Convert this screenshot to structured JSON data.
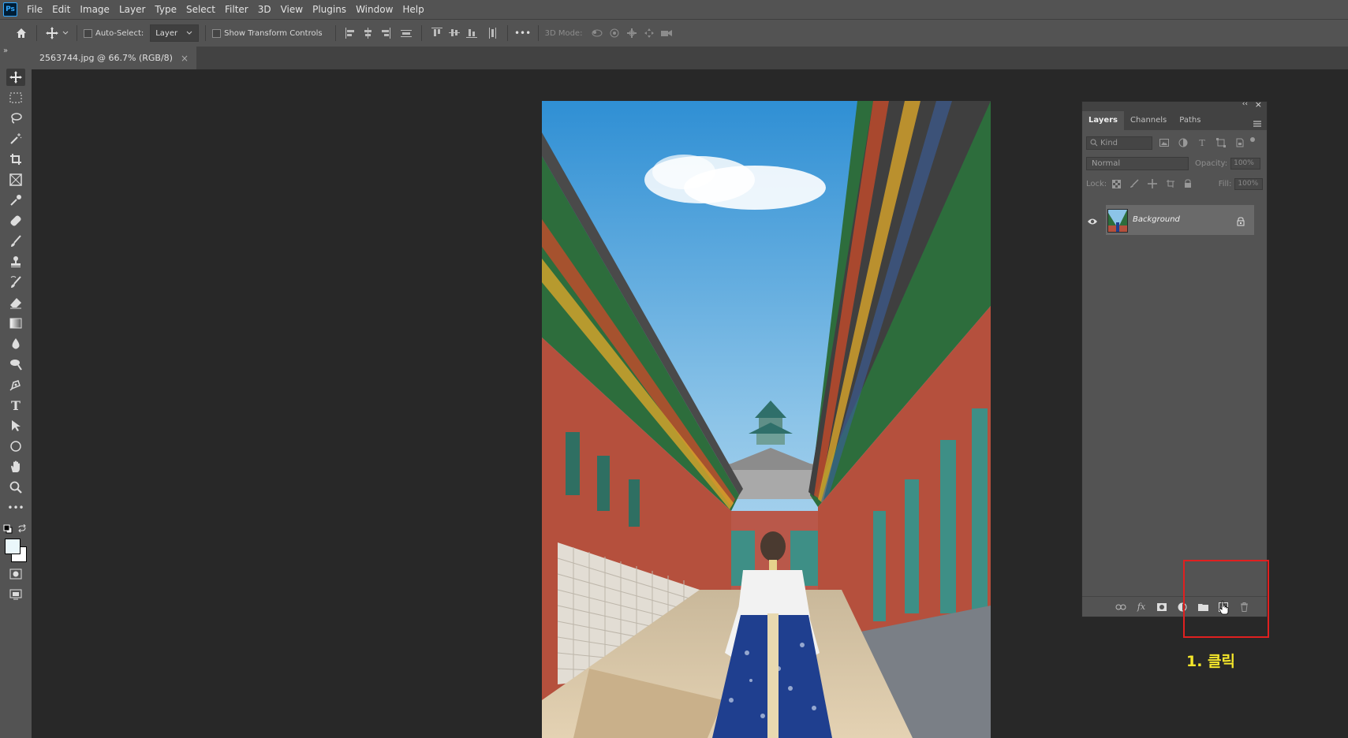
{
  "app": {
    "logo_text": "Ps"
  },
  "menu": [
    "File",
    "Edit",
    "Image",
    "Layer",
    "Type",
    "Select",
    "Filter",
    "3D",
    "View",
    "Plugins",
    "Window",
    "Help"
  ],
  "options_bar": {
    "auto_select_label": "Auto-Select:",
    "auto_select_target": "Layer",
    "show_transform_label": "Show Transform Controls",
    "mode_3d_label": "3D Mode:",
    "more_label": "•••"
  },
  "document_tab": {
    "title": "2563744.jpg @ 66.7% (RGB/8)",
    "close": "×"
  },
  "toolbar": {
    "collapse_label": "»",
    "more_tools": "•••"
  },
  "layers_panel": {
    "tabs": [
      "Layers",
      "Channels",
      "Paths"
    ],
    "kind_placeholder": "Kind",
    "blend_mode": "Normal",
    "opacity_label": "Opacity:",
    "opacity_value": "100%",
    "lock_label": "Lock:",
    "fill_label": "Fill:",
    "fill_value": "100%",
    "layers": [
      {
        "name": "Background",
        "locked": true,
        "visible": true
      }
    ],
    "panel_collapse": "‹‹",
    "panel_close": "×"
  },
  "annotation": {
    "label": "1. 클릭",
    "color": "#f4e62a",
    "box_color": "#e02020"
  }
}
